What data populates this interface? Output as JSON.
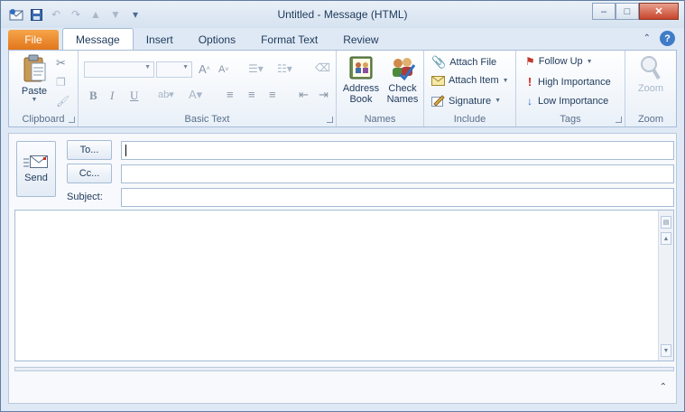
{
  "window": {
    "title": "Untitled  -  Message (HTML)"
  },
  "quick_access": {
    "icons": [
      "app-icon",
      "save-icon",
      "undo-icon",
      "redo-icon",
      "previous-icon",
      "next-icon",
      "customize-icon"
    ]
  },
  "tabs": [
    {
      "label": "File"
    },
    {
      "label": "Message"
    },
    {
      "label": "Insert"
    },
    {
      "label": "Options"
    },
    {
      "label": "Format Text"
    },
    {
      "label": "Review"
    }
  ],
  "ribbon": {
    "clipboard": {
      "label": "Clipboard",
      "paste": "Paste"
    },
    "basic_text": {
      "label": "Basic Text"
    },
    "names": {
      "label": "Names",
      "address_book_line1": "Address",
      "address_book_line2": "Book",
      "check_names_line1": "Check",
      "check_names_line2": "Names"
    },
    "include": {
      "label": "Include",
      "attach_file": "Attach File",
      "attach_item": "Attach Item",
      "signature": "Signature"
    },
    "tags": {
      "label": "Tags",
      "follow_up": "Follow Up",
      "high_importance": "High Importance",
      "low_importance": "Low Importance"
    },
    "zoom": {
      "label": "Zoom",
      "zoom_button": "Zoom"
    }
  },
  "compose": {
    "send": "Send",
    "to": "To...",
    "cc": "Cc...",
    "subject_label": "Subject:",
    "to_value": "",
    "cc_value": "",
    "subject_value": ""
  },
  "colors": {
    "file_tab": "#e2761b",
    "accent": "#3f7cc8",
    "follow_up_flag": "#c0392b",
    "high_importance": "#d0271d",
    "low_importance": "#2a66c9"
  }
}
